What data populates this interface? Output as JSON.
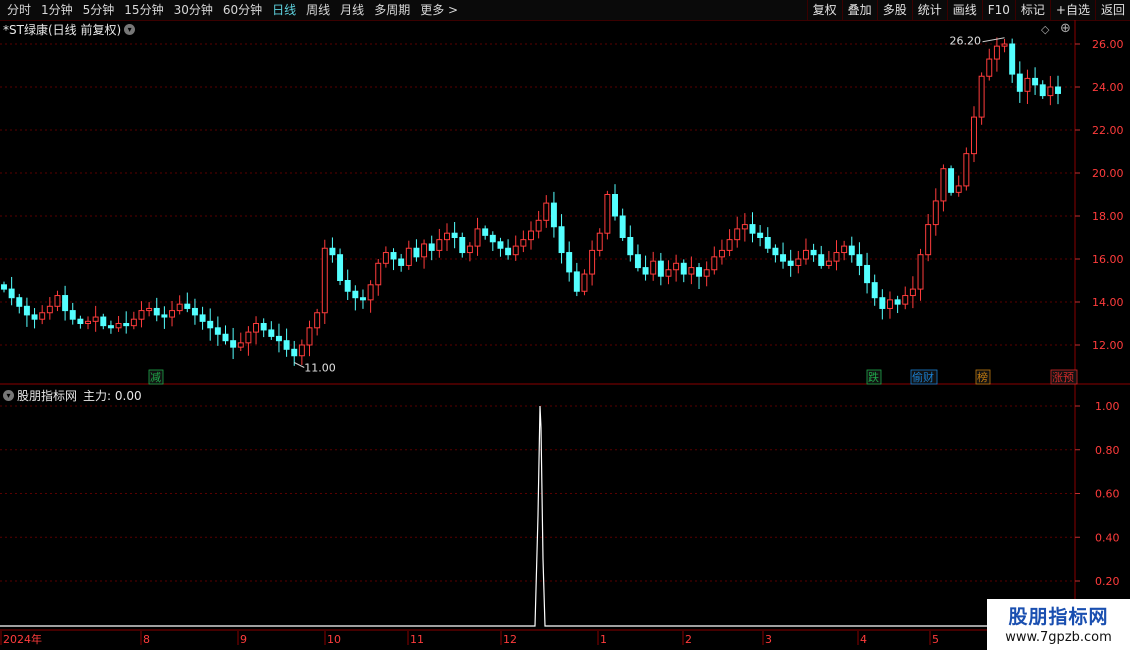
{
  "toolbar": {
    "periods": [
      "分时",
      "1分钟",
      "5分钟",
      "15分钟",
      "30分钟",
      "60分钟",
      "日线",
      "周线",
      "月线",
      "多周期",
      "更多 >"
    ],
    "active_period": "日线",
    "buttons": [
      "复权",
      "叠加",
      "多股",
      "统计",
      "画线",
      "F10",
      "标记",
      "+自选",
      "返回"
    ]
  },
  "stock": {
    "title": "*ST绿康(日线 前复权)",
    "toggle_icon": "chevron-down-icon"
  },
  "price_chart": {
    "y_ticks": [
      "26.00",
      "24.00",
      "22.00",
      "20.00",
      "18.00",
      "16.00",
      "14.00",
      "12.00"
    ],
    "high_label": "26.20",
    "low_label": "11.00",
    "event_markers": [
      {
        "text": "减",
        "color": "#1fa84a"
      },
      {
        "text": "跌",
        "color": "#1fa84a"
      },
      {
        "text": "偷财",
        "color": "#1a7fd0"
      },
      {
        "text": "榜",
        "color": "#c07a10"
      },
      {
        "text": "涨预",
        "color": "#d02a2a"
      }
    ]
  },
  "indicator": {
    "name": "股朋指标网",
    "label": "主力: 0.00",
    "y_ticks": [
      "1.00",
      "0.80",
      "0.60",
      "0.40",
      "0.20"
    ]
  },
  "x_axis": {
    "labels": [
      "2024年",
      "8",
      "9",
      "10",
      "11",
      "12",
      "1",
      "2",
      "3",
      "4",
      "5"
    ]
  },
  "watermark": {
    "title": "股朋指标网",
    "url": "www.7gpzb.com"
  },
  "colors": {
    "up": "#ff3c3c",
    "down": "#54ffff",
    "background": "#000000",
    "grid": "#7a0000"
  },
  "chart_data": {
    "type": "candlestick",
    "title": "*ST绿康(日线 前复权)",
    "x_labels": [
      "2024年",
      "8",
      "9",
      "10",
      "11",
      "12",
      "1",
      "2",
      "3",
      "4",
      "5"
    ],
    "ylim": [
      11,
      26.5
    ],
    "max_price": 26.2,
    "min_price": 11.0,
    "close_series": [
      14.6,
      14.2,
      13.8,
      13.4,
      13.2,
      13.5,
      13.8,
      14.3,
      13.6,
      13.2,
      13.0,
      13.1,
      13.3,
      12.9,
      12.8,
      13.0,
      12.9,
      13.2,
      13.6,
      13.7,
      13.4,
      13.3,
      13.6,
      13.9,
      13.7,
      13.4,
      13.1,
      12.8,
      12.5,
      12.2,
      11.9,
      12.1,
      12.6,
      13.0,
      12.7,
      12.4,
      12.2,
      11.8,
      11.5,
      12.0,
      12.8,
      13.5,
      16.5,
      16.2,
      15.0,
      14.5,
      14.2,
      14.1,
      14.8,
      15.8,
      16.3,
      16.0,
      15.7,
      16.5,
      16.1,
      16.7,
      16.4,
      16.9,
      17.2,
      17.0,
      16.3,
      16.6,
      17.4,
      17.1,
      16.8,
      16.5,
      16.2,
      16.6,
      16.9,
      17.3,
      17.8,
      18.6,
      17.5,
      16.3,
      15.4,
      14.5,
      15.3,
      16.4,
      17.2,
      19.0,
      18.0,
      17.0,
      16.2,
      15.6,
      15.3,
      15.9,
      15.2,
      15.5,
      15.8,
      15.3,
      15.6,
      15.2,
      15.5,
      16.1,
      16.4,
      16.9,
      17.4,
      17.6,
      17.2,
      17.0,
      16.5,
      16.2,
      15.9,
      15.7,
      16.0,
      16.4,
      16.2,
      15.7,
      15.9,
      16.3,
      16.6,
      16.2,
      15.7,
      14.9,
      14.2,
      13.7,
      14.1,
      13.9,
      14.3,
      14.6,
      16.2,
      17.6,
      18.7,
      20.2,
      19.1,
      19.4,
      20.9,
      22.6,
      24.5,
      25.3,
      25.9,
      26.0,
      24.6,
      23.8,
      24.4,
      24.1,
      23.6,
      24.0,
      23.7
    ]
  }
}
